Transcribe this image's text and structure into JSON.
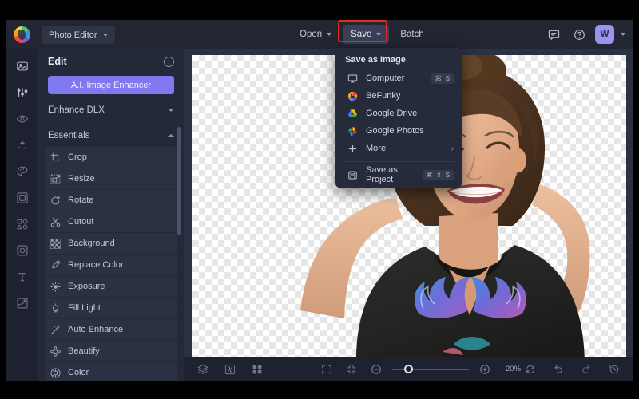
{
  "topbar": {
    "logo_icon": "befunky-logo-icon",
    "app_select": {
      "label": "Photo Editor",
      "icon": "chevron-down-icon"
    },
    "menu": [
      {
        "label": "Open",
        "icon": "chevron-down-icon",
        "active": false
      },
      {
        "label": "Save",
        "icon": "chevron-down-icon",
        "active": true
      },
      {
        "label": "Batch",
        "icon": "",
        "active": false
      }
    ],
    "right_icons": [
      "chat-bubble-icon",
      "help-circle-icon"
    ],
    "avatar_initial": "W",
    "avatar_chevron": "chevron-down-icon",
    "highlight_color": "#e02b20"
  },
  "rail": {
    "items": [
      {
        "name": "image-icon"
      },
      {
        "name": "adjust-sliders-icon"
      },
      {
        "name": "eye-icon"
      },
      {
        "name": "effects-sparkle-icon"
      },
      {
        "name": "artsy-palette-icon"
      },
      {
        "name": "frames-icon"
      },
      {
        "name": "graphics-shapes-icon"
      },
      {
        "name": "overlays-icon"
      },
      {
        "name": "text-icon"
      },
      {
        "name": "textures-icon"
      }
    ]
  },
  "sidebar": {
    "title": "Edit",
    "info_icon": "info-icon",
    "ai_button": "A.I. Image Enhancer",
    "ai_button_color": "#7f78ee",
    "sections": [
      {
        "label": "Enhance DLX",
        "expanded": false,
        "icon": "chevron-down-icon"
      },
      {
        "label": "Essentials",
        "expanded": true,
        "icon": "chevron-up-icon"
      }
    ],
    "tools": [
      {
        "label": "Crop",
        "icon": "crop-icon"
      },
      {
        "label": "Resize",
        "icon": "resize-icon"
      },
      {
        "label": "Rotate",
        "icon": "rotate-icon"
      },
      {
        "label": "Cutout",
        "icon": "scissors-icon"
      },
      {
        "label": "Background",
        "icon": "checker-background-icon"
      },
      {
        "label": "Replace Color",
        "icon": "eyedropper-icon"
      },
      {
        "label": "Exposure",
        "icon": "brightness-icon"
      },
      {
        "label": "Fill Light",
        "icon": "bulb-icon"
      },
      {
        "label": "Auto Enhance",
        "icon": "magic-wand-icon"
      },
      {
        "label": "Beautify",
        "icon": "beautify-icon"
      },
      {
        "label": "Color",
        "icon": "color-wheel-icon"
      }
    ]
  },
  "save_menu": {
    "title": "Save as Image",
    "items": [
      {
        "label": "Computer",
        "icon": "monitor-icon",
        "shortcut": "⌘ S"
      },
      {
        "label": "BeFunky",
        "icon": "befunky-logo-icon",
        "shortcut": ""
      },
      {
        "label": "Google Drive",
        "icon": "google-drive-icon",
        "shortcut": ""
      },
      {
        "label": "Google Photos",
        "icon": "google-photos-icon",
        "shortcut": ""
      },
      {
        "label": "More",
        "icon": "plus-icon",
        "shortcut": "",
        "submenu_arrow": "›"
      }
    ],
    "project_item": {
      "label": "Save as Project",
      "icon": "save-project-icon",
      "shortcut": "⌘ ⇧ S"
    }
  },
  "canvas": {
    "transparent_background": true,
    "photo_description": "woman smiling with hands behind head wearing dark t-shirt with blue purple wing graphic"
  },
  "bottombar": {
    "left_icons": [
      {
        "name": "layers-icon"
      },
      {
        "name": "compare-icon"
      },
      {
        "name": "grid-view-icon"
      }
    ],
    "view_icons": [
      {
        "name": "fullscreen-icon"
      },
      {
        "name": "fit-to-screen-icon"
      }
    ],
    "zoom_out_icon": "zoom-out-icon",
    "zoom_in_icon": "zoom-in-icon",
    "zoom_level": "20%",
    "slider_position_pct": 16,
    "right_icons": [
      {
        "name": "reset-icon"
      },
      {
        "name": "undo-icon"
      },
      {
        "name": "redo-icon"
      },
      {
        "name": "history-icon"
      }
    ]
  }
}
